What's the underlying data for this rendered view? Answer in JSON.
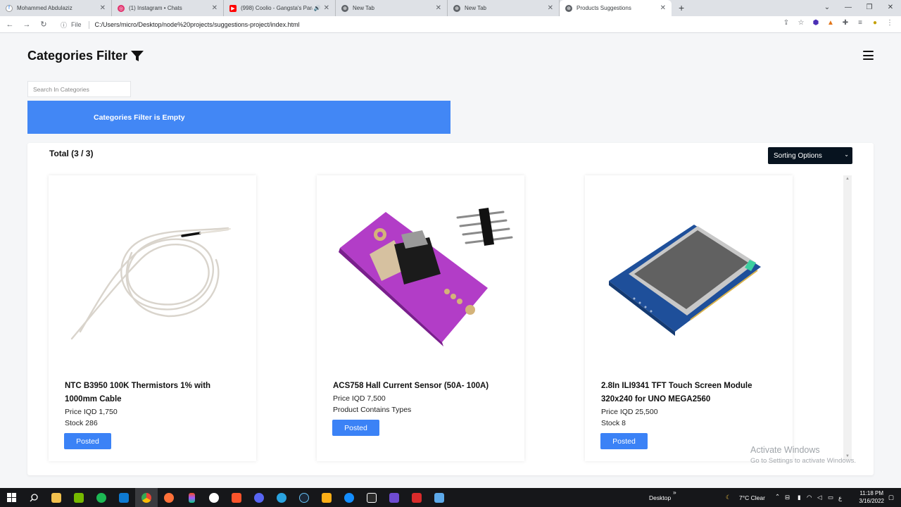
{
  "browser": {
    "tabs": [
      {
        "title": "Mohammed Abdulaziz",
        "favicon_color": "#ffffff",
        "favicon_glyph": "f"
      },
      {
        "title": "(1) Instagram • Chats",
        "favicon_color": "#e1306c",
        "favicon_glyph": "◎"
      },
      {
        "title": "(998) Coolio - Gangsta's Para",
        "favicon_color": "#ff0000",
        "favicon_glyph": "▶"
      },
      {
        "title": "New Tab",
        "favicon_color": "#5f6368",
        "favicon_glyph": "⊕"
      },
      {
        "title": "New Tab",
        "favicon_color": "#5f6368",
        "favicon_glyph": "⊕"
      },
      {
        "title": "Products Suggestions",
        "favicon_color": "#5f6368",
        "favicon_glyph": "⊕"
      }
    ],
    "file_tag": "File",
    "url": "C:/Users/micro/Desktop/node%20projects/suggestions-project/index.html"
  },
  "page": {
    "title": "Categories Filter",
    "search_placeholder": "Search In Categories",
    "alert_text": "Categories Filter is Empty",
    "total_text": "Total (3 / 3)",
    "sort_label": "Sorting Options",
    "products": [
      {
        "name": "NTC B3950 100K Thermistors 1% with 1000mm Cable",
        "price": "Price IQD 1,750",
        "extra": "Stock 286",
        "button": "Posted",
        "image": "thermistor-cable"
      },
      {
        "name": "ACS758 Hall Current Sensor (50A- 100A)",
        "price": "Price IQD 7,500",
        "extra": "Product Contains Types",
        "button": "Posted",
        "image": "current-sensor-board"
      },
      {
        "name": "2.8In ILI9341 TFT Touch Screen Module 320x240 for UNO MEGA2560",
        "price": "Price IQD 25,500",
        "extra": "Stock 8",
        "button": "Posted",
        "image": "tft-screen-module"
      }
    ]
  },
  "watermark": {
    "line1": "Activate Windows",
    "line2": "Go to Settings to activate Windows."
  },
  "taskbar": {
    "desktop_label": "Desktop",
    "weather": "7°C  Clear",
    "time": "11:18 PM",
    "date": "3/16/2022",
    "lang": "ع"
  }
}
